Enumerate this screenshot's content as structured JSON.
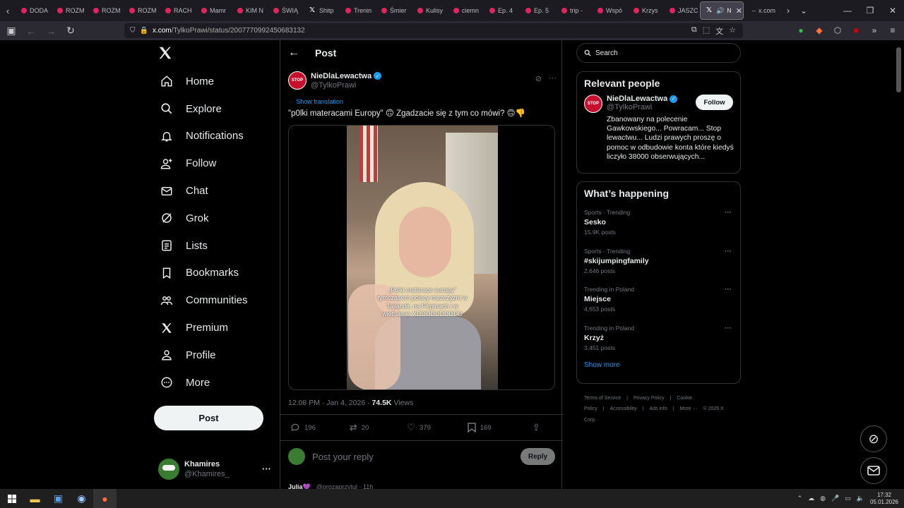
{
  "browser": {
    "tabs": [
      {
        "label": "DODA"
      },
      {
        "label": "ROZM"
      },
      {
        "label": "ROZM"
      },
      {
        "label": "ROZM"
      },
      {
        "label": "RACH"
      },
      {
        "label": "Mamr"
      },
      {
        "label": "KIM N"
      },
      {
        "label": "ŚWIĄ"
      },
      {
        "label": "Shitp"
      },
      {
        "label": "Trenin"
      },
      {
        "label": "Śmier"
      },
      {
        "label": "Kulisy"
      },
      {
        "label": "ciemn"
      },
      {
        "label": "Ep. 4"
      },
      {
        "label": "Ep. 5"
      },
      {
        "label": "trip -"
      },
      {
        "label": "Wspó"
      },
      {
        "label": "Krzys"
      },
      {
        "label": "JASZC"
      }
    ],
    "active_tab": {
      "label": "N"
    },
    "new_tab": {
      "label": "x.com"
    },
    "url_domain": "x.com",
    "url_path": "/TylkoPrawi/status/2007770992450683132"
  },
  "sidebar": {
    "items": [
      {
        "label": "Home",
        "icon": "home-icon"
      },
      {
        "label": "Explore",
        "icon": "search-icon"
      },
      {
        "label": "Notifications",
        "icon": "bell-icon"
      },
      {
        "label": "Follow",
        "icon": "person-add-icon"
      },
      {
        "label": "Chat",
        "icon": "mail-icon"
      },
      {
        "label": "Grok",
        "icon": "grok-icon"
      },
      {
        "label": "Lists",
        "icon": "list-icon"
      },
      {
        "label": "Bookmarks",
        "icon": "bookmark-icon"
      },
      {
        "label": "Communities",
        "icon": "communities-icon"
      },
      {
        "label": "Premium",
        "icon": "x-icon"
      },
      {
        "label": "Profile",
        "icon": "person-icon"
      },
      {
        "label": "More",
        "icon": "more-circle-icon"
      }
    ],
    "post_button": "Post",
    "account": {
      "name": "Khamires",
      "handle": "@Khamires_"
    }
  },
  "post": {
    "header_title": "Post",
    "author_name": "NieDlaLewactwa",
    "author_handle": "@TylkoPrawi",
    "avatar_text": "STOP",
    "show_translation": "Show translation",
    "text": "\"p0lki materacami Europy\" 🙃 Zgadzacie się z tym co mówi? 🙃👎",
    "video_caption": "„Polki materace europy\" tymczasem polscy mezczyzni w Tajlandii, na Filipinach i w wietnamie XDDDDDDDDDD",
    "time": "12:08 PM · Jan 4, 2026 · ",
    "views_count": "74.5K",
    "views_label": "Views",
    "replies": "196",
    "reposts": "20",
    "likes": "379",
    "bookmarks": "169",
    "reply_placeholder": "Post your reply",
    "reply_button": "Reply",
    "next_reply_name": "Julia💜",
    "next_reply_meta": "@prozaprzytul · 11h"
  },
  "right": {
    "search_placeholder": "Search",
    "relevant_title": "Relevant people",
    "person": {
      "name": "NieDlaLewactwa",
      "handle": "@TylkoPrawi",
      "follow_label": "Follow",
      "bio": "Zbanowany na polecenie Gawkowskiego... Powracam... Stop lewactwu... Ludzi prawych proszę o pomoc w odbudowie konta które kiedyś liczyło 38000 obserwujących..."
    },
    "happening_title": "What’s happening",
    "trends": [
      {
        "category": "Sports · Trending",
        "name": "Sesko",
        "count": "15.9K posts"
      },
      {
        "category": "Sports · Trending",
        "name": "#skijumpingfamily",
        "count": "2,646 posts"
      },
      {
        "category": "Trending in Poland",
        "name": "Miejsce",
        "count": "4,653 posts"
      },
      {
        "category": "Trending in Poland",
        "name": "Krzyż",
        "count": "3,451 posts"
      }
    ],
    "show_more": "Show more",
    "footer": [
      "Terms of Service",
      "|",
      "Privacy Policy",
      "|",
      "Cookie Policy",
      "|",
      "Accessibility",
      "|",
      "Ads info",
      "|",
      "More ···",
      "© 2026 X Corp."
    ]
  },
  "taskbar": {
    "time": "17:32",
    "date": "05.01.2026"
  },
  "colors": {
    "accent": "#1d9bf0",
    "background": "#000000",
    "secondary_text": "#71767b"
  }
}
